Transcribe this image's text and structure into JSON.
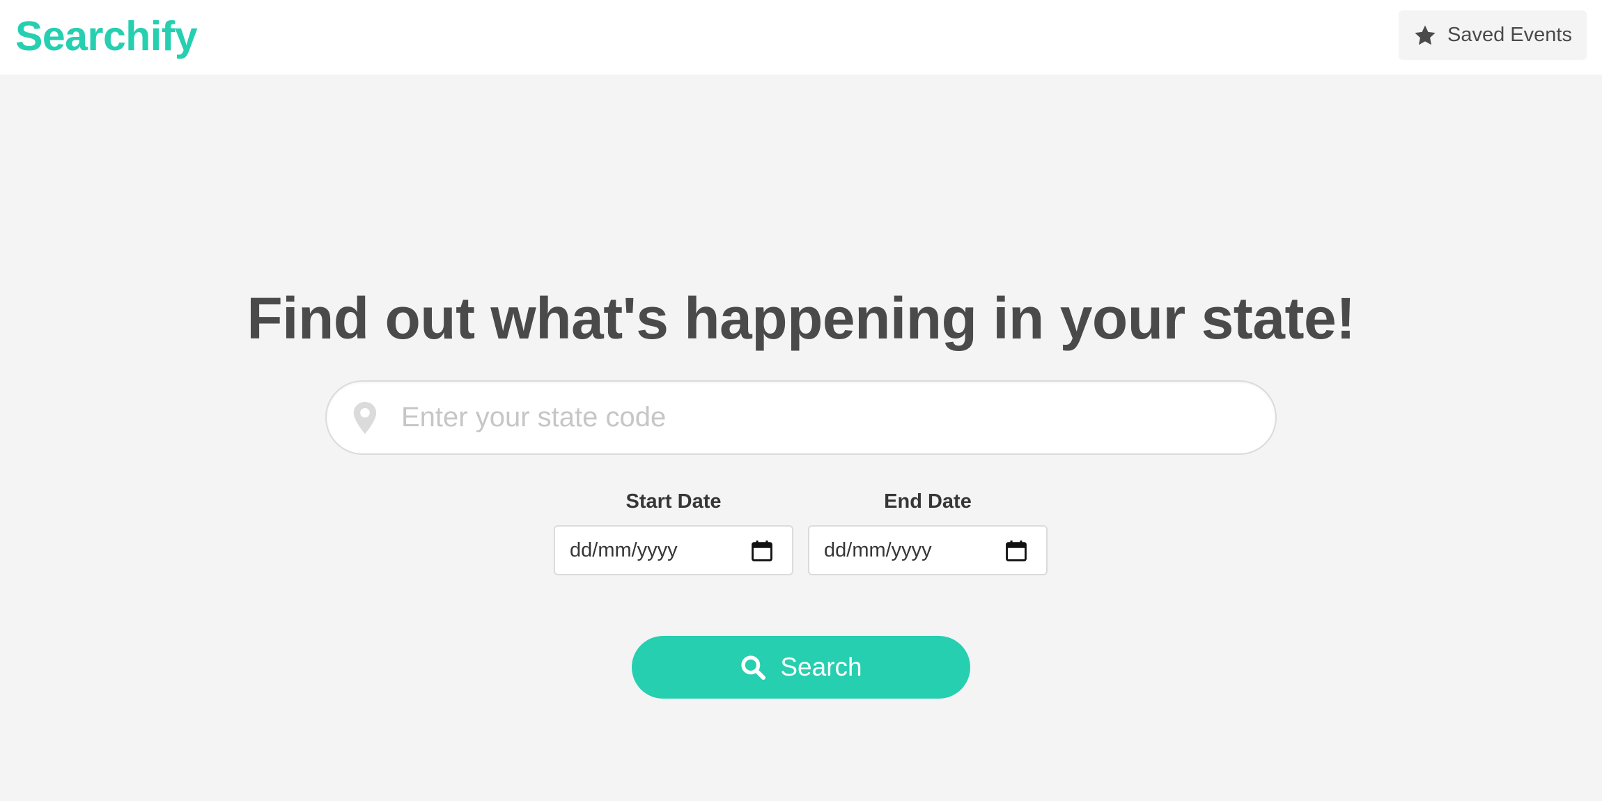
{
  "brand": {
    "name": "Searchify",
    "color": "#25cfb0"
  },
  "navbar": {
    "saved_events": {
      "label": "Saved Events",
      "icon": "star-icon"
    }
  },
  "hero": {
    "title": "Find out what's happening in your state!"
  },
  "search": {
    "placeholder": "Enter your state code",
    "value": "",
    "icon": "map-pin-icon"
  },
  "dates": {
    "start": {
      "label": "Start Date",
      "value": "dd/mm/yyyy",
      "icon": "calendar-icon"
    },
    "end": {
      "label": "End Date",
      "value": "dd/mm/yyyy",
      "icon": "calendar-icon"
    }
  },
  "search_button": {
    "label": "Search",
    "icon": "magnifier-icon",
    "color": "#25cfb0"
  },
  "colors": {
    "background": "#f4f4f4",
    "text": "#4a4a4a",
    "accent": "#25cfb0"
  }
}
